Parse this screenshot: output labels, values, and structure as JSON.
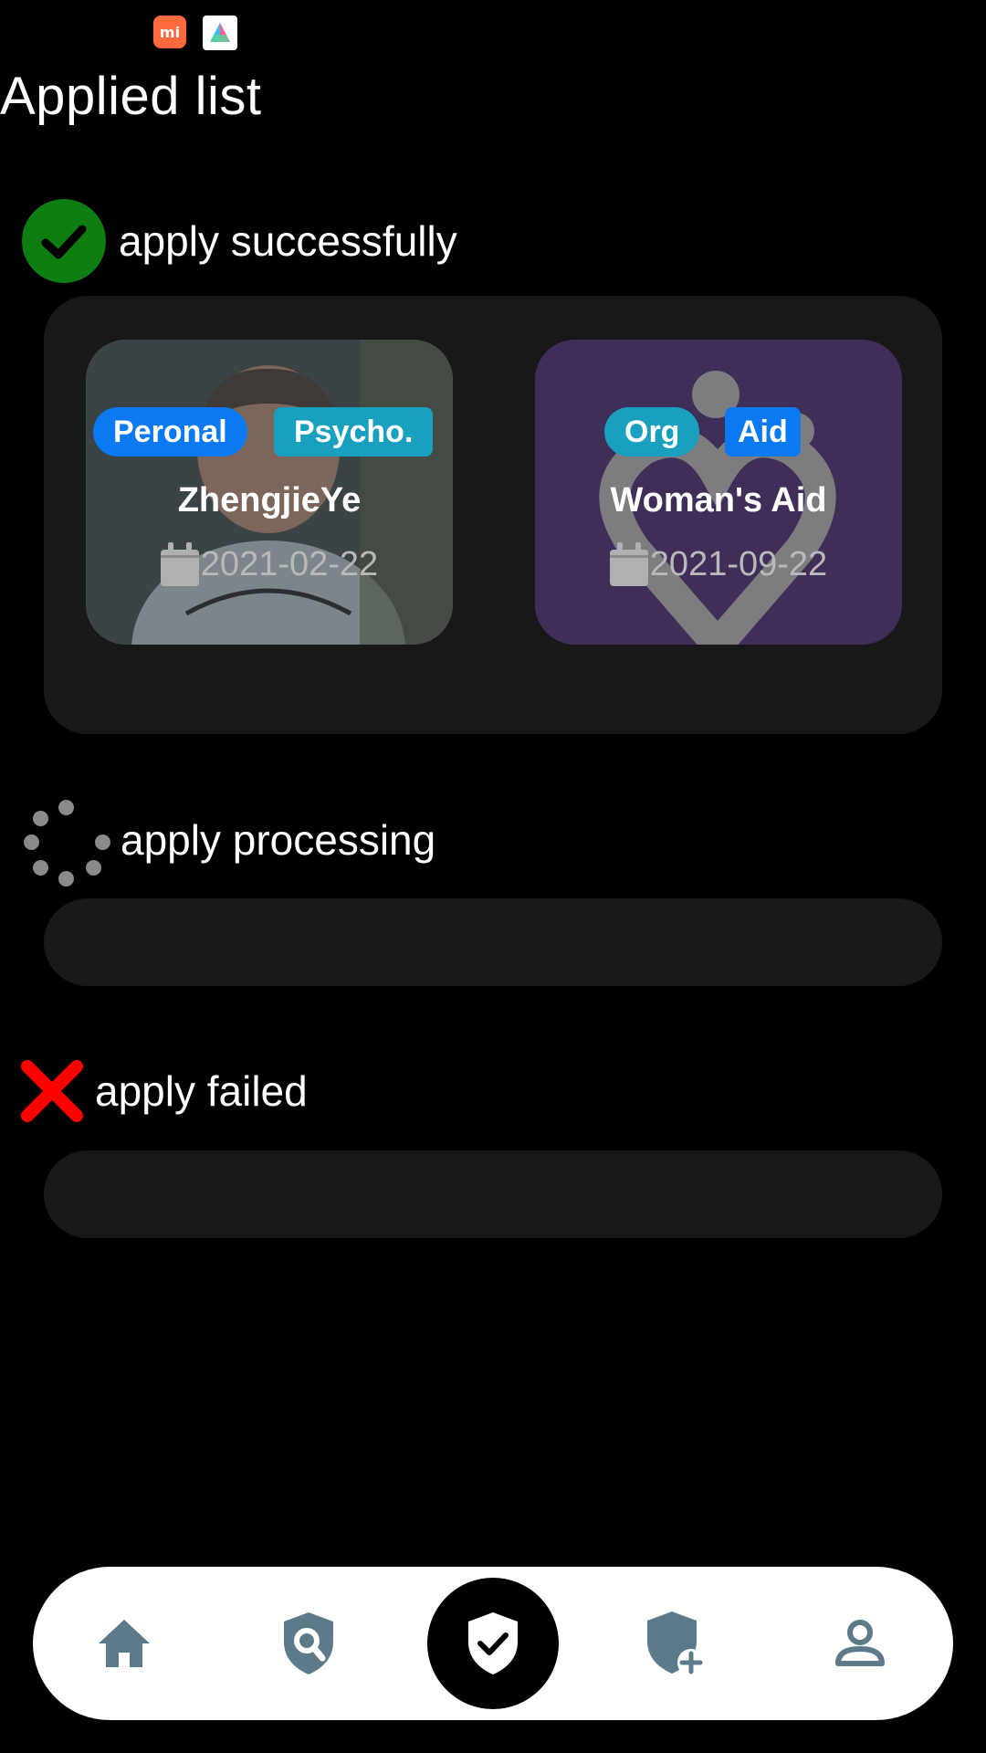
{
  "status_bar": {
    "app_icons": [
      "mi-app-icon",
      "a-app-icon"
    ],
    "mi_label": "mi"
  },
  "page": {
    "title": "Applied list"
  },
  "sections": {
    "success": {
      "label": "apply successfully",
      "icon": "check-circle-icon",
      "color": "#0e7d12",
      "cards": [
        {
          "tags": [
            "Peronal",
            "Psycho."
          ],
          "name": "ZhengjieYe",
          "date": "2021-02-22",
          "icon": "calendar-icon"
        },
        {
          "tags": [
            "Org",
            "Aid"
          ],
          "name": "Woman's Aid",
          "date": "2021-09-22",
          "icon": "calendar-icon"
        }
      ]
    },
    "processing": {
      "label": "apply processing",
      "icon": "spinner-icon"
    },
    "failed": {
      "label": "apply failed",
      "icon": "cross-icon",
      "color": "#ff0000"
    }
  },
  "bottom_nav": {
    "items": [
      "home-icon",
      "shield-search-icon",
      "shield-check-icon",
      "shield-add-icon",
      "person-icon"
    ],
    "active": "shield-check-icon",
    "icon_color": "#5c7a8a"
  },
  "colors": {
    "tag_blue": "#0a79f2",
    "tag_teal": "#1aa0bf",
    "panel": "#181818"
  }
}
